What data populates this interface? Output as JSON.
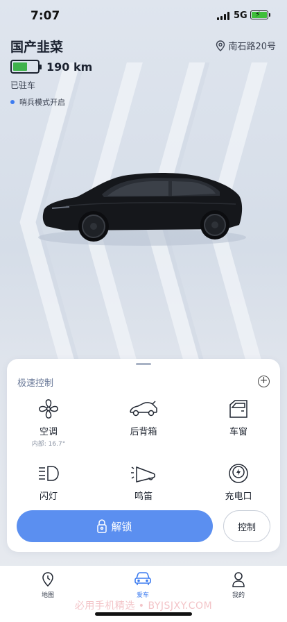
{
  "status_bar": {
    "time": "7:07",
    "network": "5G"
  },
  "vehicle": {
    "name": "国产韭菜",
    "location": "南石路20号",
    "range": "190 km",
    "battery_level": 0.6,
    "park_status": "已驻车",
    "sentry_mode": "哨兵模式开启"
  },
  "quick_controls": {
    "title": "极速控制",
    "add_icon": "plus-circle-icon",
    "items": [
      {
        "label": "空调",
        "sub": "内部: 16.7°",
        "icon": "fan-icon"
      },
      {
        "label": "后背箱",
        "icon": "trunk-icon"
      },
      {
        "label": "车窗",
        "icon": "window-icon"
      },
      {
        "label": "闪灯",
        "icon": "headlight-icon"
      },
      {
        "label": "鸣笛",
        "icon": "horn-icon"
      },
      {
        "label": "充电口",
        "icon": "charge-port-icon"
      }
    ],
    "unlock_label": "解锁",
    "control_label": "控制"
  },
  "tabs": [
    {
      "label": "地图",
      "icon": "map-pin-icon"
    },
    {
      "label": "爱车",
      "icon": "car-icon",
      "active": true
    },
    {
      "label": "我的",
      "icon": "profile-icon"
    }
  ],
  "watermark": "必用手机精选 • BYJSJXY.COM",
  "colors": {
    "accent": "#5b8ff0",
    "battery": "#3fb24b",
    "sentry_dot": "#3d7cf0"
  }
}
